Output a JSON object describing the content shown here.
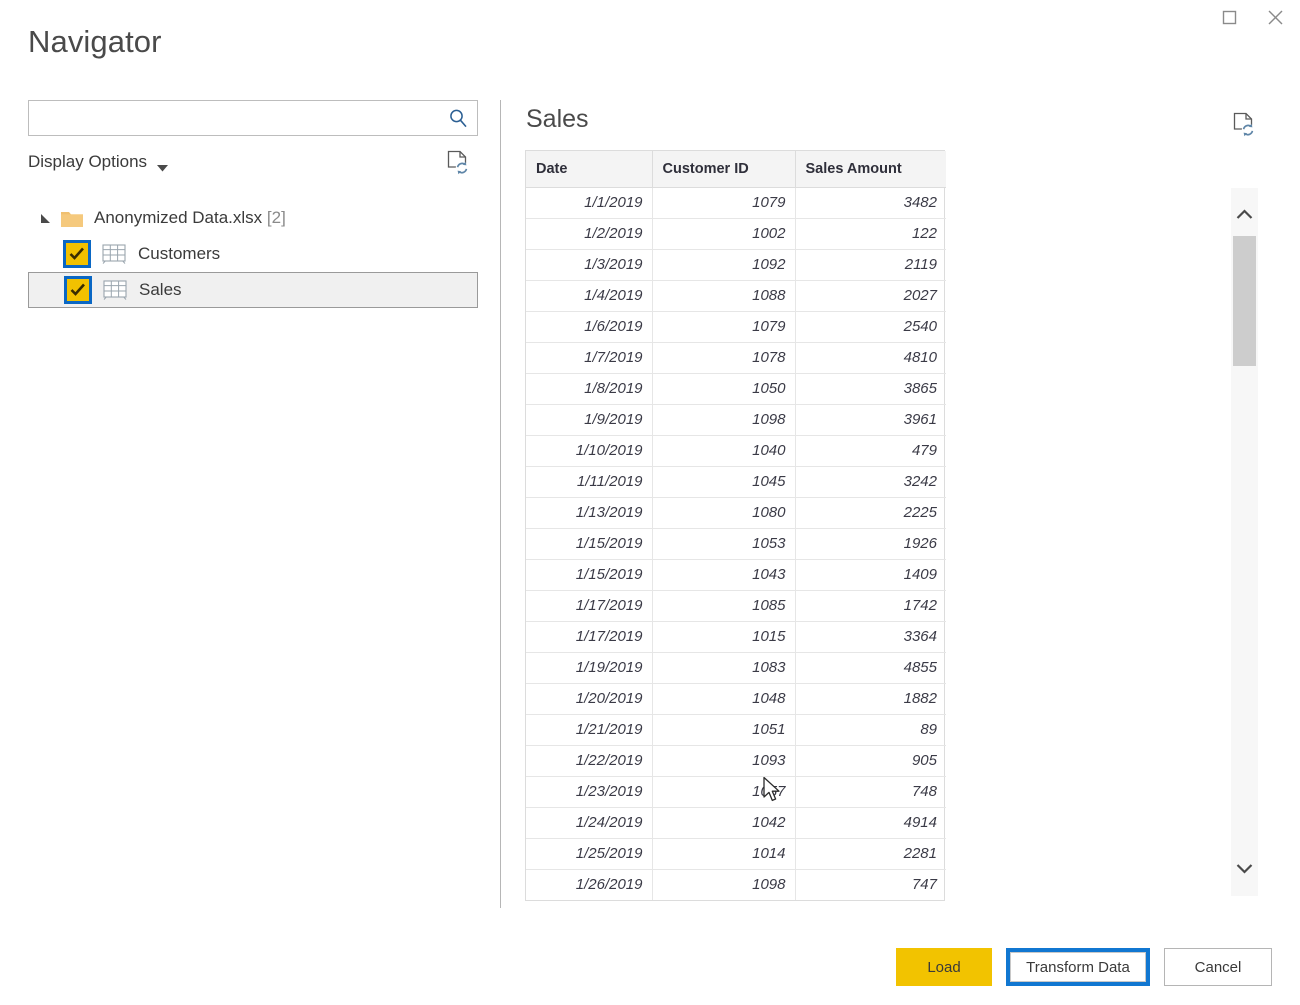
{
  "window": {
    "maximize_icon": "maximize-icon",
    "close_icon": "close-icon"
  },
  "dialog": {
    "title": "Navigator"
  },
  "search": {
    "value": "",
    "placeholder": "",
    "icon": "search-icon"
  },
  "display_options": {
    "label": "Display Options",
    "chevron_icon": "chevron-down-icon",
    "refresh_icon": "refresh-page-icon"
  },
  "tree": {
    "root": {
      "label": "Anonymized Data.xlsx",
      "count": "[2]",
      "expander_icon": "expander-expanded-icon",
      "folder_icon": "folder-icon",
      "expanded": true
    },
    "items": [
      {
        "label": "Customers",
        "checked": true,
        "selected": false,
        "icon": "table-icon"
      },
      {
        "label": "Sales",
        "checked": true,
        "selected": true,
        "icon": "table-icon"
      }
    ]
  },
  "preview": {
    "title": "Sales",
    "refresh_icon": "refresh-page-icon",
    "columns": [
      "Date",
      "Customer ID",
      "Sales Amount"
    ],
    "rows": [
      [
        "1/1/2019",
        "1079",
        "3482"
      ],
      [
        "1/2/2019",
        "1002",
        "122"
      ],
      [
        "1/3/2019",
        "1092",
        "2119"
      ],
      [
        "1/4/2019",
        "1088",
        "2027"
      ],
      [
        "1/6/2019",
        "1079",
        "2540"
      ],
      [
        "1/7/2019",
        "1078",
        "4810"
      ],
      [
        "1/8/2019",
        "1050",
        "3865"
      ],
      [
        "1/9/2019",
        "1098",
        "3961"
      ],
      [
        "1/10/2019",
        "1040",
        "479"
      ],
      [
        "1/11/2019",
        "1045",
        "3242"
      ],
      [
        "1/13/2019",
        "1080",
        "2225"
      ],
      [
        "1/15/2019",
        "1053",
        "1926"
      ],
      [
        "1/15/2019",
        "1043",
        "1409"
      ],
      [
        "1/17/2019",
        "1085",
        "1742"
      ],
      [
        "1/17/2019",
        "1015",
        "3364"
      ],
      [
        "1/19/2019",
        "1083",
        "4855"
      ],
      [
        "1/20/2019",
        "1048",
        "1882"
      ],
      [
        "1/21/2019",
        "1051",
        "89"
      ],
      [
        "1/22/2019",
        "1093",
        "905"
      ],
      [
        "1/23/2019",
        "1057",
        "748"
      ],
      [
        "1/24/2019",
        "1042",
        "4914"
      ],
      [
        "1/25/2019",
        "1014",
        "2281"
      ],
      [
        "1/26/2019",
        "1098",
        "747"
      ]
    ]
  },
  "scrollbar": {
    "up_icon": "chevron-up-icon",
    "down_icon": "chevron-down-icon"
  },
  "footer": {
    "load_label": "Load",
    "transform_label": "Transform Data",
    "cancel_label": "Cancel"
  },
  "colors": {
    "accent_yellow": "#F2C300",
    "focus_blue": "#1177D1",
    "checkbox_outline_blue": "#0A67C4",
    "folder_tan": "#F0C070"
  }
}
